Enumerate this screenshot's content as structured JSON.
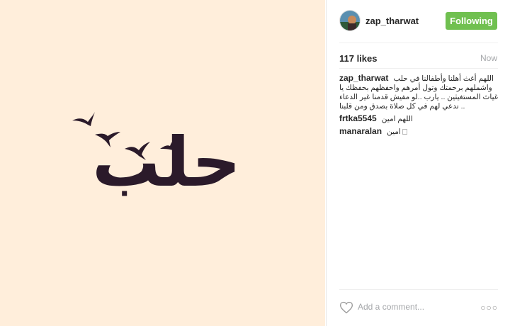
{
  "post": {
    "image_caption_art": "حلب"
  },
  "header": {
    "username": "zap_tharwat",
    "follow_label": "Following"
  },
  "stats": {
    "likes": "117 likes",
    "time": "Now"
  },
  "comments": [
    {
      "user": "zap_tharwat",
      "text": "اللهم أغث أهلنا وأطفالنا في حلب واشملهم برحمتك وتول أمرهم واحفظهم بحفظك يا غياث المستغيثين .. يارب ..لو مفيش قدمنا غير الدعاء .. ندعي لهم في كل صلاة بصدق ومن قلبنا"
    },
    {
      "user": "frtka5545",
      "text": "اللهم امين"
    },
    {
      "user": "manaralan",
      "text": "امين"
    }
  ],
  "footer": {
    "add_comment_placeholder": "Add a comment...",
    "more_label": "○○○"
  },
  "colors": {
    "image_background": "#ffeedb",
    "follow_button": "#70c050",
    "calligraphy": "#2b1a2a"
  },
  "icons": {
    "like": "heart-icon",
    "options": "more-options-icon"
  }
}
